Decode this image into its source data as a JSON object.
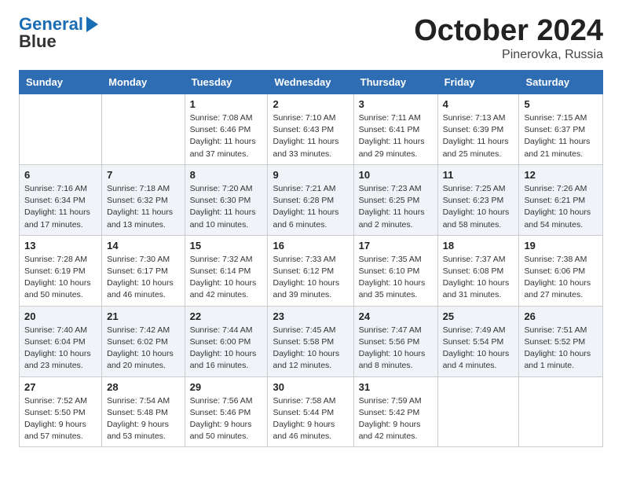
{
  "header": {
    "logo_line1": "General",
    "logo_line2": "Blue",
    "month": "October 2024",
    "location": "Pinerovka, Russia"
  },
  "weekdays": [
    "Sunday",
    "Monday",
    "Tuesday",
    "Wednesday",
    "Thursday",
    "Friday",
    "Saturday"
  ],
  "weeks": [
    [
      {
        "day": "",
        "info": ""
      },
      {
        "day": "",
        "info": ""
      },
      {
        "day": "1",
        "info": "Sunrise: 7:08 AM\nSunset: 6:46 PM\nDaylight: 11 hours\nand 37 minutes."
      },
      {
        "day": "2",
        "info": "Sunrise: 7:10 AM\nSunset: 6:43 PM\nDaylight: 11 hours\nand 33 minutes."
      },
      {
        "day": "3",
        "info": "Sunrise: 7:11 AM\nSunset: 6:41 PM\nDaylight: 11 hours\nand 29 minutes."
      },
      {
        "day": "4",
        "info": "Sunrise: 7:13 AM\nSunset: 6:39 PM\nDaylight: 11 hours\nand 25 minutes."
      },
      {
        "day": "5",
        "info": "Sunrise: 7:15 AM\nSunset: 6:37 PM\nDaylight: 11 hours\nand 21 minutes."
      }
    ],
    [
      {
        "day": "6",
        "info": "Sunrise: 7:16 AM\nSunset: 6:34 PM\nDaylight: 11 hours\nand 17 minutes."
      },
      {
        "day": "7",
        "info": "Sunrise: 7:18 AM\nSunset: 6:32 PM\nDaylight: 11 hours\nand 13 minutes."
      },
      {
        "day": "8",
        "info": "Sunrise: 7:20 AM\nSunset: 6:30 PM\nDaylight: 11 hours\nand 10 minutes."
      },
      {
        "day": "9",
        "info": "Sunrise: 7:21 AM\nSunset: 6:28 PM\nDaylight: 11 hours\nand 6 minutes."
      },
      {
        "day": "10",
        "info": "Sunrise: 7:23 AM\nSunset: 6:25 PM\nDaylight: 11 hours\nand 2 minutes."
      },
      {
        "day": "11",
        "info": "Sunrise: 7:25 AM\nSunset: 6:23 PM\nDaylight: 10 hours\nand 58 minutes."
      },
      {
        "day": "12",
        "info": "Sunrise: 7:26 AM\nSunset: 6:21 PM\nDaylight: 10 hours\nand 54 minutes."
      }
    ],
    [
      {
        "day": "13",
        "info": "Sunrise: 7:28 AM\nSunset: 6:19 PM\nDaylight: 10 hours\nand 50 minutes."
      },
      {
        "day": "14",
        "info": "Sunrise: 7:30 AM\nSunset: 6:17 PM\nDaylight: 10 hours\nand 46 minutes."
      },
      {
        "day": "15",
        "info": "Sunrise: 7:32 AM\nSunset: 6:14 PM\nDaylight: 10 hours\nand 42 minutes."
      },
      {
        "day": "16",
        "info": "Sunrise: 7:33 AM\nSunset: 6:12 PM\nDaylight: 10 hours\nand 39 minutes."
      },
      {
        "day": "17",
        "info": "Sunrise: 7:35 AM\nSunset: 6:10 PM\nDaylight: 10 hours\nand 35 minutes."
      },
      {
        "day": "18",
        "info": "Sunrise: 7:37 AM\nSunset: 6:08 PM\nDaylight: 10 hours\nand 31 minutes."
      },
      {
        "day": "19",
        "info": "Sunrise: 7:38 AM\nSunset: 6:06 PM\nDaylight: 10 hours\nand 27 minutes."
      }
    ],
    [
      {
        "day": "20",
        "info": "Sunrise: 7:40 AM\nSunset: 6:04 PM\nDaylight: 10 hours\nand 23 minutes."
      },
      {
        "day": "21",
        "info": "Sunrise: 7:42 AM\nSunset: 6:02 PM\nDaylight: 10 hours\nand 20 minutes."
      },
      {
        "day": "22",
        "info": "Sunrise: 7:44 AM\nSunset: 6:00 PM\nDaylight: 10 hours\nand 16 minutes."
      },
      {
        "day": "23",
        "info": "Sunrise: 7:45 AM\nSunset: 5:58 PM\nDaylight: 10 hours\nand 12 minutes."
      },
      {
        "day": "24",
        "info": "Sunrise: 7:47 AM\nSunset: 5:56 PM\nDaylight: 10 hours\nand 8 minutes."
      },
      {
        "day": "25",
        "info": "Sunrise: 7:49 AM\nSunset: 5:54 PM\nDaylight: 10 hours\nand 4 minutes."
      },
      {
        "day": "26",
        "info": "Sunrise: 7:51 AM\nSunset: 5:52 PM\nDaylight: 10 hours\nand 1 minute."
      }
    ],
    [
      {
        "day": "27",
        "info": "Sunrise: 7:52 AM\nSunset: 5:50 PM\nDaylight: 9 hours\nand 57 minutes."
      },
      {
        "day": "28",
        "info": "Sunrise: 7:54 AM\nSunset: 5:48 PM\nDaylight: 9 hours\nand 53 minutes."
      },
      {
        "day": "29",
        "info": "Sunrise: 7:56 AM\nSunset: 5:46 PM\nDaylight: 9 hours\nand 50 minutes."
      },
      {
        "day": "30",
        "info": "Sunrise: 7:58 AM\nSunset: 5:44 PM\nDaylight: 9 hours\nand 46 minutes."
      },
      {
        "day": "31",
        "info": "Sunrise: 7:59 AM\nSunset: 5:42 PM\nDaylight: 9 hours\nand 42 minutes."
      },
      {
        "day": "",
        "info": ""
      },
      {
        "day": "",
        "info": ""
      }
    ]
  ]
}
